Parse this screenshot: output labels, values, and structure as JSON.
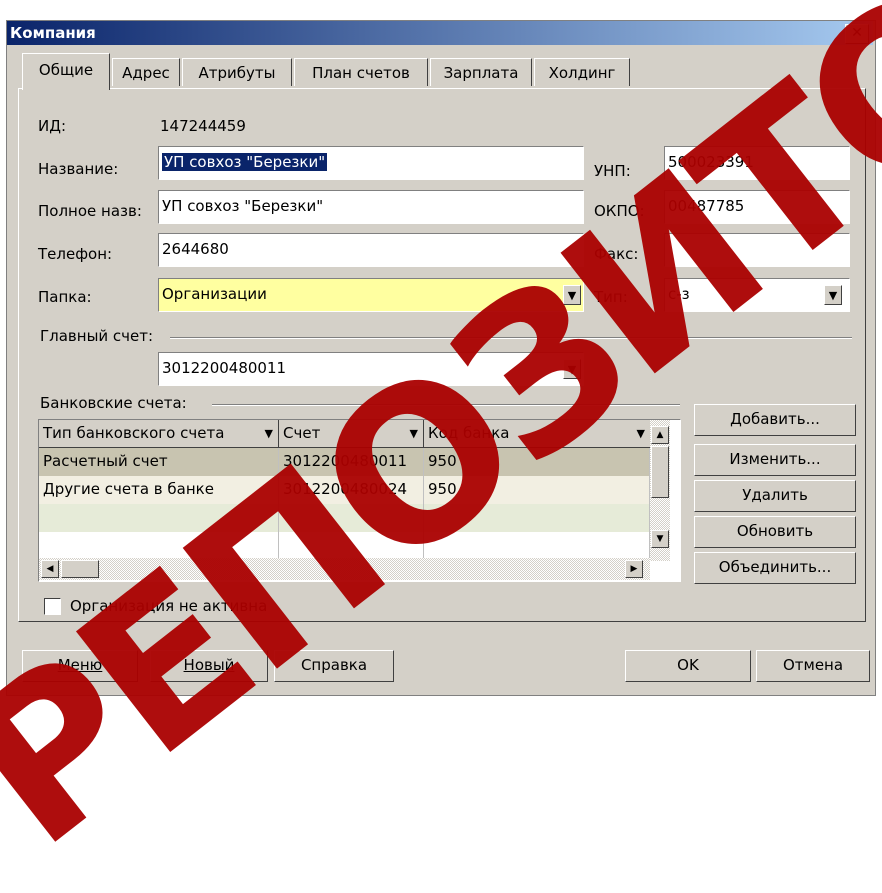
{
  "window": {
    "title": "Компания",
    "close_glyph": "✕"
  },
  "tabs": [
    {
      "label": "Общие",
      "active": true
    },
    {
      "label": "Адрес"
    },
    {
      "label": "Атрибуты"
    },
    {
      "label": "План счетов"
    },
    {
      "label": "Зарплата"
    },
    {
      "label": "Холдинг"
    }
  ],
  "form": {
    "id_label": "ИД:",
    "id_value": "147244459",
    "name_label": "Название:",
    "name_value": "УП совхоз \"Березки\"",
    "fullname_label": "Полное назв:",
    "fullname_value": "УП совхоз \"Березки\"",
    "phone_label": "Телефон:",
    "phone_value": "2644680",
    "folder_label": "Папка:",
    "folder_value": "Организации",
    "unp_label": "УНП:",
    "unp_value": "500023391",
    "okpo_label": "ОКПО:",
    "okpo_value": "00487785",
    "fax_label": "Факс:",
    "fax_value": "",
    "type_label": "Тип:",
    "type_value": "с-з",
    "main_account_label": "Главный счет:",
    "main_account_value": "3012200480011",
    "bank_accounts_label": "Банковские счета:",
    "inactive_label": "Организация не активна",
    "inactive_checked": false
  },
  "grid": {
    "columns": [
      "Тип банковского счета",
      "Счет",
      "Код банка"
    ],
    "rows": [
      [
        "Расчетный счет",
        "3012200480011",
        "950"
      ],
      [
        "Другие счета в банке",
        "3012200480024",
        "950"
      ]
    ]
  },
  "side_buttons": [
    "Добавить...",
    "Изменить...",
    "Удалить",
    "Обновить",
    "Объединить..."
  ],
  "bottom_buttons": {
    "menu": "Меню",
    "new": "Новый",
    "help": "Справка",
    "ok": "OK",
    "cancel": "Отмена"
  },
  "watermark": {
    "text": "РЕПОЗИТОРИЙ",
    "color": "#aa0000"
  },
  "colors": {
    "title_bar": "#0a246a",
    "dialog_bg": "#d4d0c8",
    "folder_field_bg": "#ffffa0",
    "selected_row_bg": "#c8c4b0",
    "alt_row_bg": "#f2efe2"
  }
}
